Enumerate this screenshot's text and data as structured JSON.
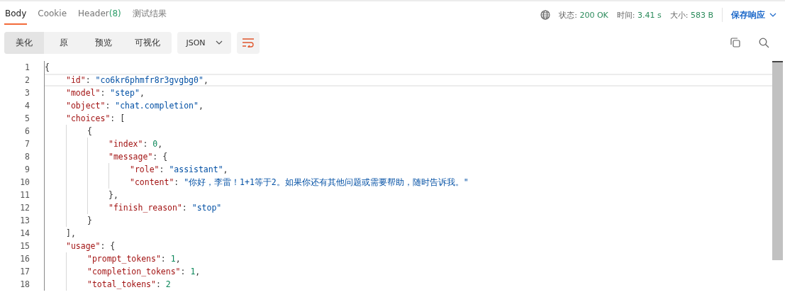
{
  "tabs": [
    {
      "label": "Body",
      "selected": true
    },
    {
      "label": "Cookie",
      "selected": false
    },
    {
      "label": "Header",
      "count": "(8)",
      "selected": false
    },
    {
      "label": "测试结果",
      "selected": false
    }
  ],
  "status": [
    {
      "label": "状态:",
      "value": "200 OK"
    },
    {
      "label": "时间:",
      "value": "3.41 s"
    },
    {
      "label": "大小:",
      "value": "583 B"
    }
  ],
  "save_button": "保存响应",
  "view_modes": [
    {
      "label": "美化",
      "selected": true
    },
    {
      "label": "原",
      "selected": false
    },
    {
      "label": "预览",
      "selected": false
    },
    {
      "label": "可视化",
      "selected": false
    }
  ],
  "format_select": "JSON",
  "wrap_enabled": true,
  "editor": {
    "lines": [
      {
        "n": "1",
        "current": false,
        "tokens": [
          {
            "kind": "punct",
            "text": "{"
          }
        ],
        "children": [
          {
            "n": "2",
            "current": true,
            "tokens": [
              {
                "kind": "key",
                "text": "\"id\""
              },
              {
                "kind": "punct",
                "text": ": "
              },
              {
                "kind": "string",
                "text": "\"co6kr6phmfr8r3gvgbg0\""
              },
              {
                "kind": "punct",
                "text": ","
              }
            ]
          },
          {
            "n": "3",
            "current": false,
            "tokens": [
              {
                "kind": "key",
                "text": "\"model\""
              },
              {
                "kind": "punct",
                "text": ": "
              },
              {
                "kind": "string",
                "text": "\"step\""
              },
              {
                "kind": "punct",
                "text": ","
              }
            ]
          },
          {
            "n": "4",
            "current": false,
            "tokens": [
              {
                "kind": "key",
                "text": "\"object\""
              },
              {
                "kind": "punct",
                "text": ": "
              },
              {
                "kind": "string",
                "text": "\"chat.completion\""
              },
              {
                "kind": "punct",
                "text": ","
              }
            ]
          },
          {
            "n": "5",
            "current": false,
            "tokens": [
              {
                "kind": "key",
                "text": "\"choices\""
              },
              {
                "kind": "punct",
                "text": ": ["
              }
            ],
            "children": [
              {
                "n": "6",
                "current": false,
                "tokens": [
                  {
                    "kind": "punct",
                    "text": "{"
                  }
                ],
                "children": [
                  {
                    "n": "7",
                    "current": false,
                    "tokens": [
                      {
                        "kind": "key",
                        "text": "\"index\""
                      },
                      {
                        "kind": "punct",
                        "text": ": "
                      },
                      {
                        "kind": "number",
                        "text": "0"
                      },
                      {
                        "kind": "punct",
                        "text": ","
                      }
                    ]
                  },
                  {
                    "n": "8",
                    "current": false,
                    "tokens": [
                      {
                        "kind": "key",
                        "text": "\"message\""
                      },
                      {
                        "kind": "punct",
                        "text": ": {"
                      }
                    ],
                    "children": [
                      {
                        "n": "9",
                        "current": false,
                        "tokens": [
                          {
                            "kind": "key",
                            "text": "\"role\""
                          },
                          {
                            "kind": "punct",
                            "text": ": "
                          },
                          {
                            "kind": "string",
                            "text": "\"assistant\""
                          },
                          {
                            "kind": "punct",
                            "text": ","
                          }
                        ]
                      },
                      {
                        "n": "10",
                        "current": false,
                        "tokens": [
                          {
                            "kind": "key",
                            "text": "\"content\""
                          },
                          {
                            "kind": "punct",
                            "text": ": "
                          },
                          {
                            "kind": "string",
                            "text": "\"你好，李雷！1+1等于2。如果你还有其他问题或需要帮助，随时告诉我。\""
                          }
                        ]
                      }
                    ]
                  },
                  {
                    "n": "11",
                    "current": false,
                    "tokens": [
                      {
                        "kind": "punct",
                        "text": "},"
                      }
                    ]
                  },
                  {
                    "n": "12",
                    "current": false,
                    "tokens": [
                      {
                        "kind": "key",
                        "text": "\"finish_reason\""
                      },
                      {
                        "kind": "punct",
                        "text": ": "
                      },
                      {
                        "kind": "string",
                        "text": "\"stop\""
                      }
                    ]
                  }
                ]
              },
              {
                "n": "13",
                "current": false,
                "tokens": [
                  {
                    "kind": "punct",
                    "text": "}"
                  }
                ]
              }
            ]
          },
          {
            "n": "14",
            "current": false,
            "tokens": [
              {
                "kind": "punct",
                "text": "],"
              }
            ]
          },
          {
            "n": "15",
            "current": false,
            "tokens": [
              {
                "kind": "key",
                "text": "\"usage\""
              },
              {
                "kind": "punct",
                "text": ": {"
              }
            ],
            "children": [
              {
                "n": "16",
                "current": false,
                "tokens": [
                  {
                    "kind": "key",
                    "text": "\"prompt_tokens\""
                  },
                  {
                    "kind": "punct",
                    "text": ": "
                  },
                  {
                    "kind": "number",
                    "text": "1"
                  },
                  {
                    "kind": "punct",
                    "text": ","
                  }
                ]
              },
              {
                "n": "17",
                "current": false,
                "tokens": [
                  {
                    "kind": "key",
                    "text": "\"completion_tokens\""
                  },
                  {
                    "kind": "punct",
                    "text": ": "
                  },
                  {
                    "kind": "number",
                    "text": "1"
                  },
                  {
                    "kind": "punct",
                    "text": ","
                  }
                ]
              },
              {
                "n": "18",
                "current": false,
                "tokens": [
                  {
                    "kind": "key",
                    "text": "\"total_tokens\""
                  },
                  {
                    "kind": "punct",
                    "text": ": "
                  },
                  {
                    "kind": "number",
                    "text": "2"
                  }
                ]
              }
            ]
          }
        ]
      }
    ]
  }
}
